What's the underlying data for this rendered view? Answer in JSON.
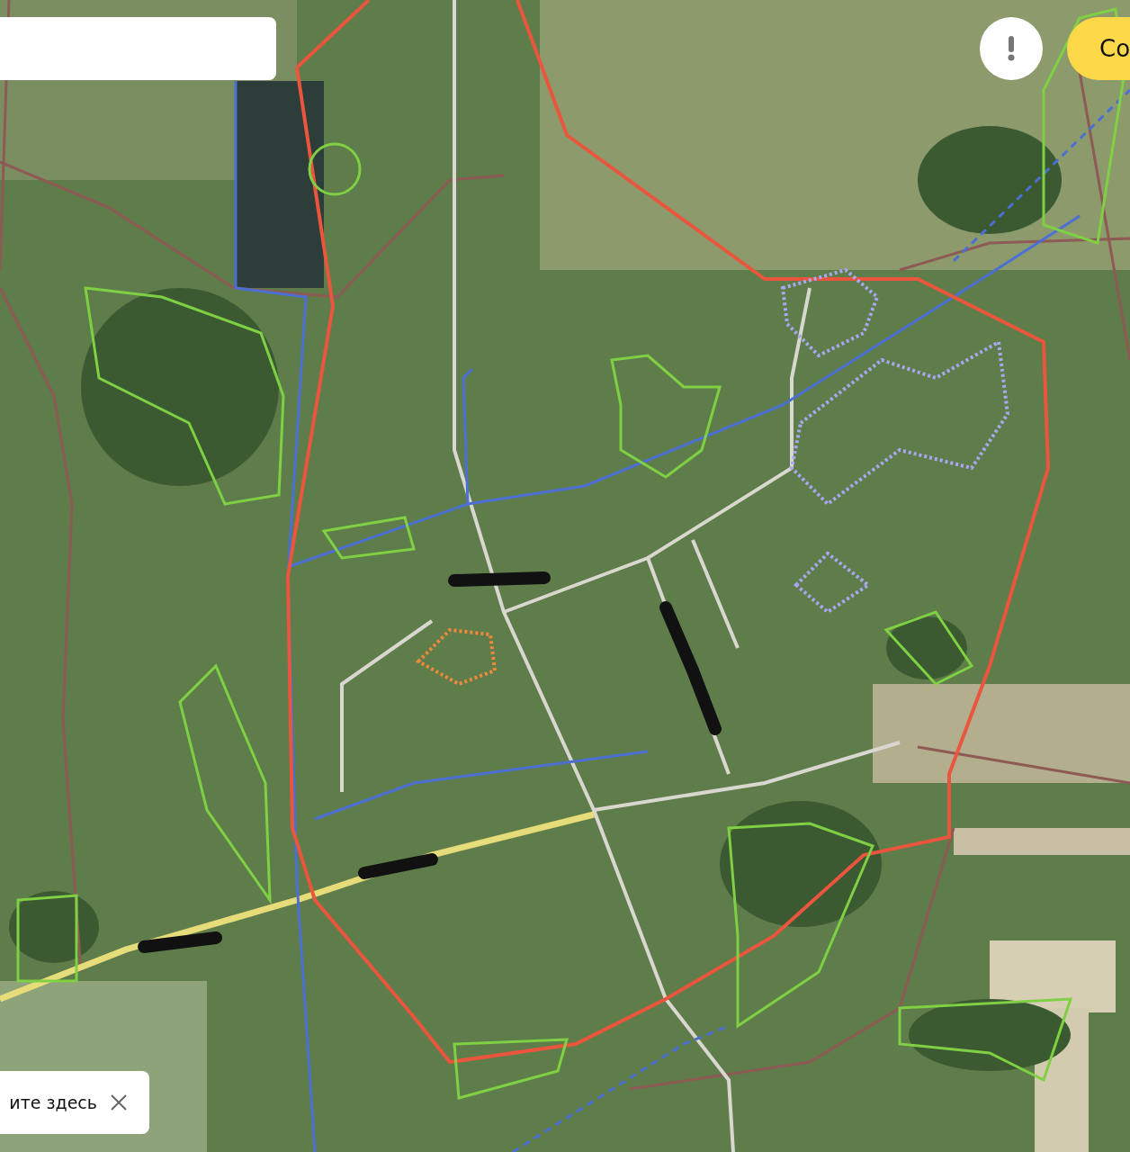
{
  "top_button": {
    "label": "Со"
  },
  "hint": {
    "text": "ите здесь"
  }
}
